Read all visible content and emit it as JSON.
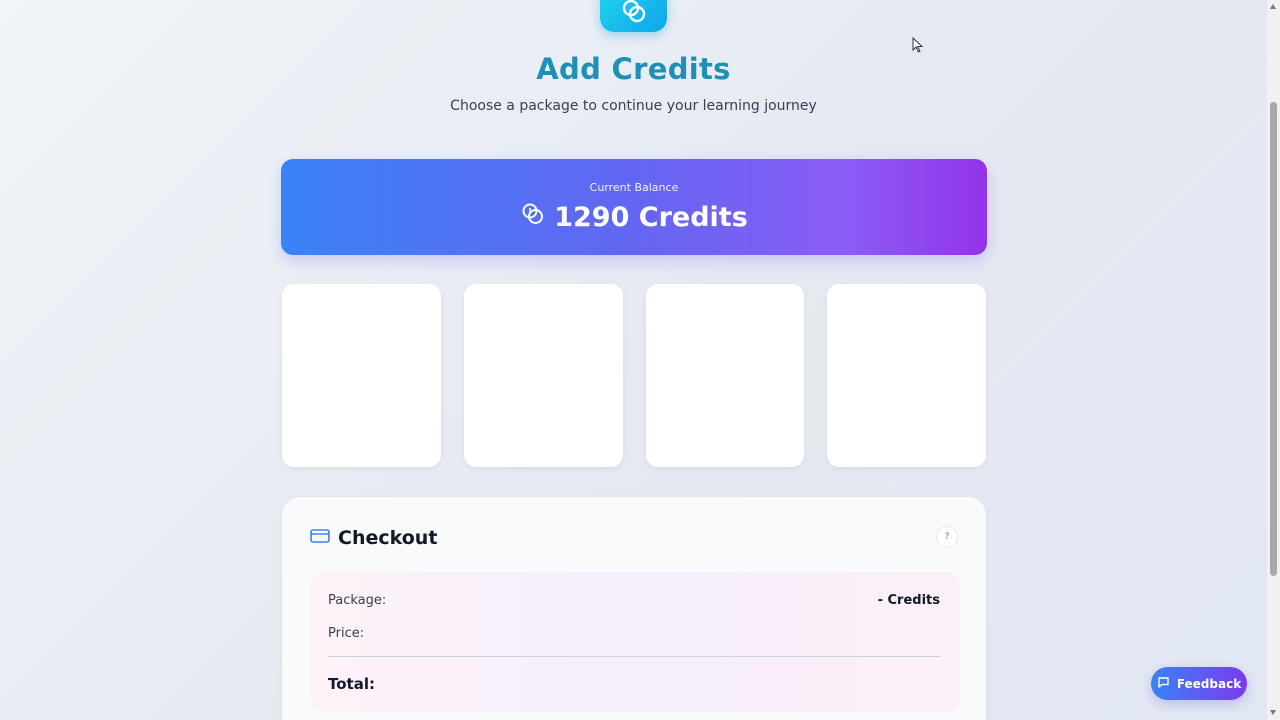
{
  "header": {
    "title": "Add Credits",
    "subtitle": "Choose a package to continue your learning journey",
    "icon": "coins-icon"
  },
  "balance": {
    "label": "Current Balance",
    "amount": "1290 Credits",
    "icon": "coins-icon",
    "gradient": [
      "#3b82f6",
      "#9333ea"
    ]
  },
  "packages": [
    {
      "name": "package-card-1"
    },
    {
      "name": "package-card-2"
    },
    {
      "name": "package-card-3"
    },
    {
      "name": "package-card-4"
    }
  ],
  "checkout": {
    "title": "Checkout",
    "icon": "credit-card-icon",
    "help_label": "?",
    "package_label": "Package:",
    "package_value": "- Credits",
    "price_label": "Price:",
    "total_label": "Total:"
  },
  "feedback": {
    "label": "Feedback",
    "icon": "chat-icon"
  },
  "colors": {
    "accent": "#1f8fb5",
    "brand_blue": "#3b82f6",
    "brand_purple": "#7c3aed"
  }
}
